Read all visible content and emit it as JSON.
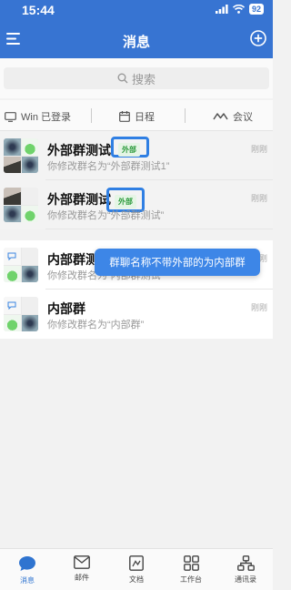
{
  "status": {
    "time": "15:44",
    "battery": "92"
  },
  "nav": {
    "title": "消息"
  },
  "search": {
    "placeholder": "搜索"
  },
  "quick": {
    "win_label": "Win 已登录",
    "schedule_label": "日程",
    "meeting_label": "会议"
  },
  "conversations": [
    {
      "title": "外部群测试",
      "tag": "外部",
      "subtitle": "你修改群名为“外部群测试1”",
      "time": "刚刚"
    },
    {
      "title": "外部群测试",
      "tag": "外部",
      "subtitle": "你修改群名为“外部群测试”",
      "time": "刚刚"
    },
    {
      "title": "内部群测试",
      "subtitle": "你修改群名为“内部群测试”",
      "time": "刚刚"
    },
    {
      "title": "内部群",
      "subtitle": "你修改群名为“内部群”",
      "time": "刚刚"
    }
  ],
  "tooltip": {
    "text": "群聊名称不带外部的为内部群"
  },
  "tabs": [
    {
      "label": "消息",
      "icon": "chat-bubble-icon",
      "active": true
    },
    {
      "label": "邮件",
      "icon": "mail-icon"
    },
    {
      "label": "文档",
      "icon": "document-icon"
    },
    {
      "label": "工作台",
      "icon": "workbench-grid-icon"
    },
    {
      "label": "通讯录",
      "icon": "contacts-icon"
    }
  ],
  "colors": {
    "brand": "#3774d2",
    "tag_bg": "#e5f5e5",
    "tag_text": "#2e9b3e",
    "highlight": "#2f7fe3",
    "tooltip": "#3d86e7"
  }
}
